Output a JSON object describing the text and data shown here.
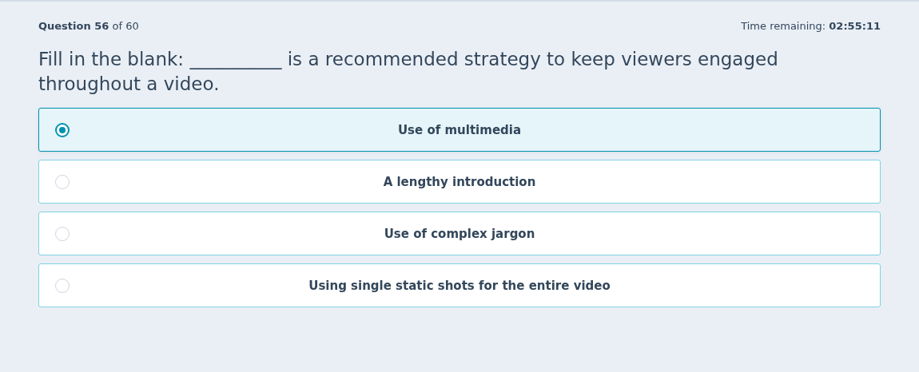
{
  "header": {
    "progress": "**Question 56** of 60",
    "timer": "Time remaining: **02:55:11**"
  },
  "question": "Fill in the blank: __________ is a recommended strategy to keep viewers engaged throughout a video.",
  "options": [
    {
      "label": "Use of multimedia",
      "selected": true
    },
    {
      "label": "A lengthy introduction",
      "selected": false
    },
    {
      "label": "Use of complex jargon",
      "selected": false
    },
    {
      "label": "Using single static shots for the entire video",
      "selected": false
    }
  ]
}
